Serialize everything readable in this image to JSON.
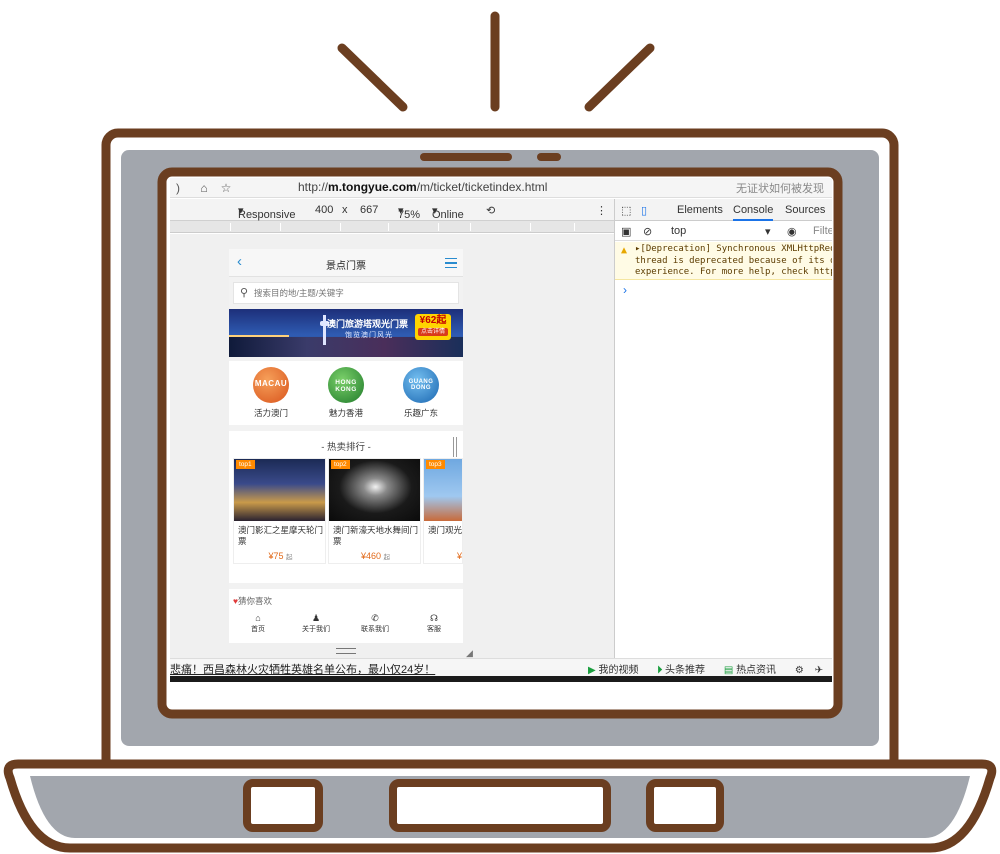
{
  "browser": {
    "url_prefix": "http://",
    "url_domain": "m.tongyue.com",
    "url_path": "/m/ticket/ticketindex.html",
    "search_hint": "无证状如何被发现"
  },
  "device_toolbar": {
    "mode": "Responsive",
    "width": "400",
    "times": "x",
    "height": "667",
    "zoom": "75%",
    "network": "Online"
  },
  "devtools": {
    "tabs": [
      "Elements",
      "Console",
      "Sources"
    ],
    "active_tab": "Console",
    "context": "top",
    "filter_placeholder": "Filte",
    "warning_line1": "▸[Deprecation] Synchronous XMLHttpRequ",
    "warning_line2": "thread is deprecated because of its det",
    "warning_line3": "experience. For more help, check https:",
    "prompt": "›"
  },
  "phone": {
    "header_title": "景点门票",
    "search_placeholder": "搜索目的地/主题/关键字",
    "banner": {
      "title": "澳门旅游塔观光门票",
      "subtitle": "饱览澳门风光",
      "price": "¥62起",
      "cta": "点击详情"
    },
    "categories": [
      {
        "label": "活力澳门",
        "badge": "MACAU",
        "color": "#e8742a"
      },
      {
        "label": "魅力香港",
        "badge": "HONG KONG",
        "color": "#2e9a3c"
      },
      {
        "label": "乐趣广东",
        "badge": "GUANG DONG",
        "color": "#2a84c8"
      }
    ],
    "ranking_title": "- 热卖排行 -",
    "products": [
      {
        "badge": "top1",
        "name": "澳门影汇之星摩天轮门票",
        "price": "¥75",
        "unit": "起"
      },
      {
        "badge": "top2",
        "name": "澳门新濠天地水舞间门票",
        "price": "¥460",
        "unit": "起"
      },
      {
        "badge": "top3",
        "name": "澳门观光塔",
        "price": "¥",
        "unit": ""
      }
    ],
    "likes_title": "猜你喜欢",
    "likes_heart": "♥",
    "tabs": [
      {
        "icon": "⌂",
        "label": "首页"
      },
      {
        "icon": "♟",
        "label": "关于我们"
      },
      {
        "icon": "✆",
        "label": "联系我们"
      },
      {
        "icon": "☊",
        "label": "客服"
      }
    ]
  },
  "newsbar": {
    "headline": "悲痛！西昌森林火灾牺牲英雄名单公布，最小仅24岁！",
    "video": "我的视频",
    "toutiao": "头条推荐",
    "hot": "热点资讯"
  },
  "colors": {
    "laptop_outline": "#6b3e20",
    "laptop_fill": "#a2a6ad",
    "accent": "#1a73e8",
    "price": "#e26a1a"
  }
}
